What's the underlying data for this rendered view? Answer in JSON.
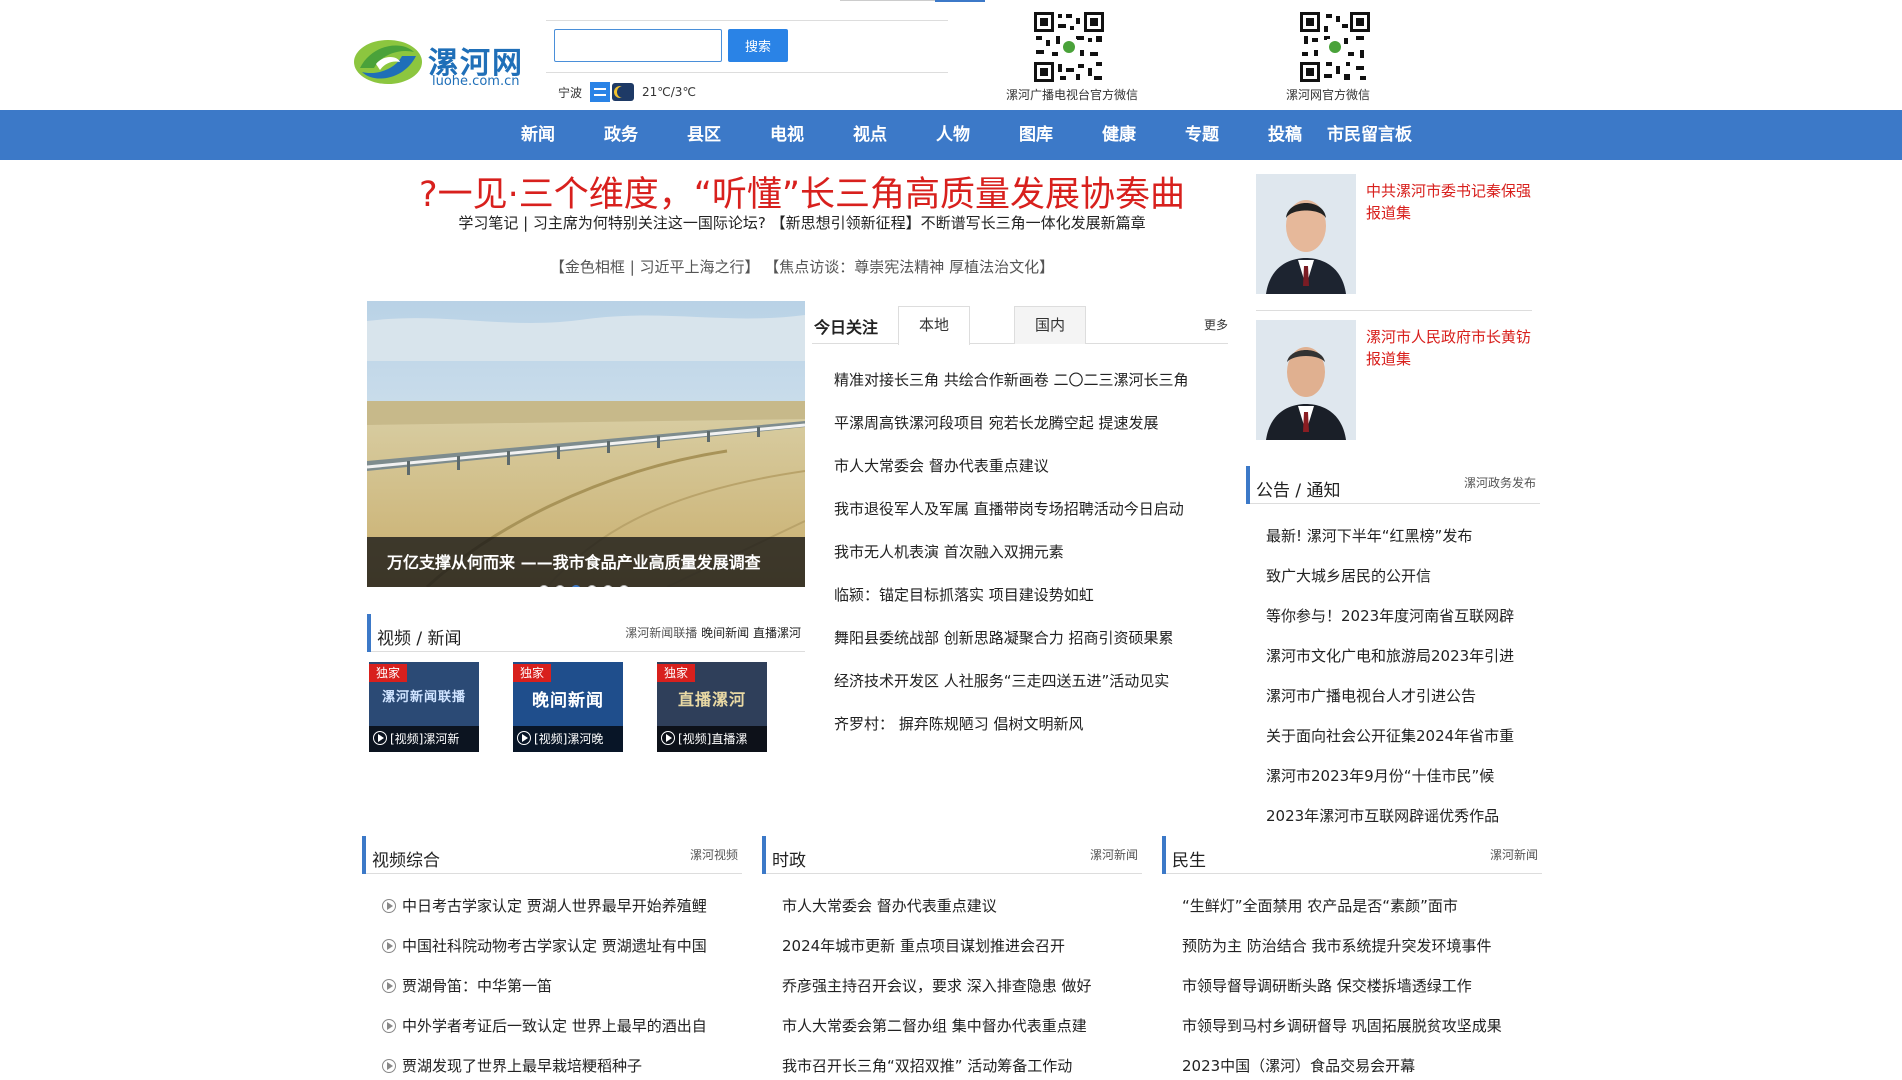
{
  "header": {
    "logo_cn": "漯河网",
    "logo_en": "luohe.com.cn",
    "search_button": "搜索",
    "search_value": "",
    "weather_city": "宁波",
    "weather_temp": "21℃/3℃",
    "qr_left_caption": "漯河广播电视台官方微信",
    "qr_right_caption": "漯河网官方微信"
  },
  "nav": [
    "新闻",
    "政务",
    "县区",
    "电视",
    "视点",
    "人物",
    "图库",
    "健康",
    "专题",
    "投稿",
    "市民留言板"
  ],
  "headline": {
    "title": "?一见·三个维度，“听懂”长三角高质量发展协奏曲",
    "sub1": "学习笔记 | 习主席为何特别关注这一国际论坛?  【新思想引领新征程】不断谱写长三角一体化发展新篇章",
    "sub2a": "【金色相框 | 习近平上海之行】",
    "sub2b": "【焦点访谈：尊崇宪法精神 厚植法治文化】"
  },
  "leaders": [
    {
      "text": "中共漯河市委书记秦保强报道集"
    },
    {
      "text": "漯河市人民政府市长黄钫报道集"
    }
  ],
  "carousel": {
    "caption": "万亿支撑从何而来 ——我市食品产业高质量发展调查",
    "slide_count": 6,
    "active_index": 2
  },
  "today": {
    "label": "今日关注",
    "tabs": [
      "本地",
      "国内"
    ],
    "more": "更多",
    "items": [
      "精准对接长三角 共绘合作新画卷 二〇二三漯河长三角",
      "平漯周高铁漯河段项目 宛若长龙腾空起 提速发展",
      "市人大常委会 督办代表重点建议",
      "我市退役军人及军属 直播带岗专场招聘活动今日启动",
      "我市无人机表演 首次融入双拥元素",
      "临颍：锚定目标抓落实 项目建设势如虹",
      "舞阳县委统战部 创新思路凝聚合力 招商引资硕果累",
      "经济技术开发区 人社服务“三走四送五进”活动见实",
      "齐罗村： 摒弃陈规陋习 倡树文明新风"
    ]
  },
  "notice": {
    "title": "公告 / 通知",
    "more": "漯河政务发布",
    "items": [
      "最新! 漯河下半年“红黑榜”发布",
      "致广大城乡居民的公开信",
      "等你参与！2023年度河南省互联网辟",
      "漯河市文化广电和旅游局2023年引进",
      "漯河市广播电视台人才引进公告",
      "关于面向社会公开征集2024年省市重",
      "漯河市2023年9月份“十佳市民”候",
      "2023年漯河市互联网辟谣优秀作品"
    ]
  },
  "video_news": {
    "title": "视频 / 新闻",
    "links": [
      "漯河新闻联播",
      "晚间新闻",
      "直播漯河"
    ],
    "thumbs": [
      {
        "badge": "独家",
        "logo": "漯河新闻联播",
        "caption": "[视频]漯河新"
      },
      {
        "badge": "独家",
        "logo": "晚间新闻",
        "caption": "[视频]漯河晚"
      },
      {
        "badge": "独家",
        "logo": "直播漯河",
        "caption": "[视频]直播漯"
      }
    ]
  },
  "video_general": {
    "title": "视频综合",
    "more": "漯河视频",
    "items": [
      "中日考古学家认定 贾湖人世界最早开始养殖鲤",
      "中国社科院动物考古学家认定 贾湖遗址有中国",
      "贾湖骨笛：中华第一笛",
      "中外学者考证后一致认定 世界上最早的酒出自",
      "贾湖发现了世界上最早栽培粳稻种子"
    ]
  },
  "politics": {
    "title": "时政",
    "more": "漯河新闻",
    "items": [
      "市人大常委会 督办代表重点建议",
      "2024年城市更新 重点项目谋划推进会召开",
      "乔彦强主持召开会议，要求 深入排查隐患 做好",
      "市人大常委会第二督办组 集中督办代表重点建",
      "我市召开长三角“双招双推” 活动筹备工作动"
    ]
  },
  "livelihood": {
    "title": "民生",
    "more": "漯河新闻",
    "items": [
      "“生鲜灯”全面禁用 农产品是否“素颜”面市",
      "预防为主 防治结合 我市系统提升突发环境事件",
      "市领导督导调研断头路 保交楼拆墙透绿工作",
      "市领导到马村乡调研督导 巩固拓展脱贫攻坚成果",
      "2023中国（漯河）食品交易会开幕"
    ]
  },
  "colors": {
    "nav_blue": "#3c79c8",
    "headline_red": "#d8201d"
  }
}
